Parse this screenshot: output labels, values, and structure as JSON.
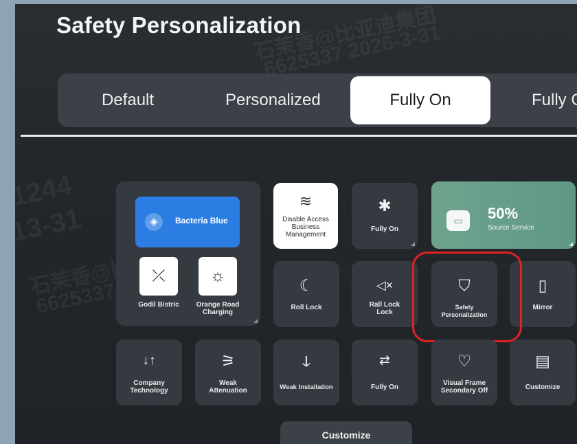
{
  "header": {
    "title": "Safety Personalization"
  },
  "tabs": [
    {
      "label": "Default",
      "active": false
    },
    {
      "label": "Personalized",
      "active": false
    },
    {
      "label": "Fully On",
      "active": true
    },
    {
      "label": "Fully C",
      "active": false
    }
  ],
  "panel": {
    "primary_label": "Bacteria Blue",
    "mini1_label": "Godil Bistric",
    "mini2_label": "Orange Road Charging"
  },
  "tiles": {
    "disable_access": "Disable Access Business Management",
    "bluetooth": "Fully On",
    "roll_lock": "Roll Lock",
    "rall_lock": "Rall Lock Lock",
    "safety": "Safety Personalization",
    "mirror": "Mirror",
    "company": "Company Technology",
    "weak_att": "Weak Attenuation",
    "weak_inst": "Weak Installation",
    "fully_on2": "Fully On",
    "visual_frame": "Visual Frame Secondary Off",
    "customize": "Customize"
  },
  "source": {
    "percent": "50%",
    "label": "Source Service"
  },
  "bottom": {
    "label": "Customize"
  },
  "watermarks": [
    "石茉香@比亚迪集团",
    "6625337 2026-3-31",
    "1244",
    "13-31",
    "石茉香@比",
    "6625337"
  ],
  "colors": {
    "accent_blue": "#2b7de3",
    "green_card": "#6fa38e",
    "highlight_red": "#e22222"
  }
}
